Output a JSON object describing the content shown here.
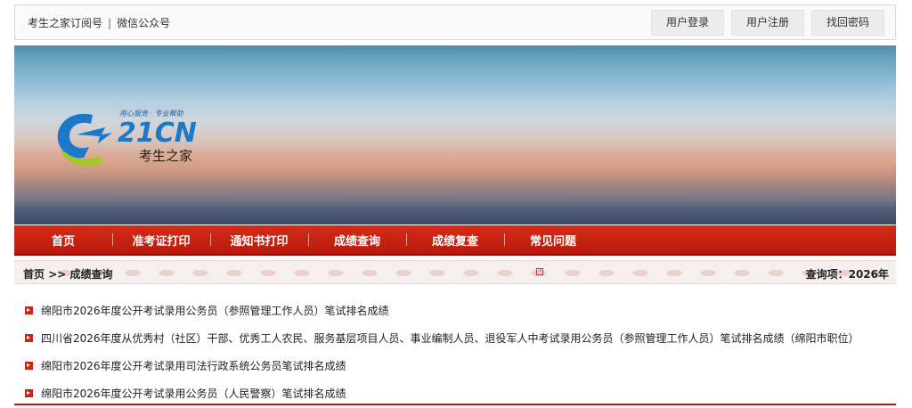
{
  "topbar": {
    "subscribe": "考生之家订阅号",
    "separator": "|",
    "wechat": "微信公众号",
    "buttons": {
      "login": "用户登录",
      "register": "用户注册",
      "recover": "找回密码"
    }
  },
  "logo": {
    "brand": "21CN",
    "slogan": "用心服务 · 专业帮助",
    "name": "考生之家"
  },
  "nav": [
    {
      "label": "首页"
    },
    {
      "label": "准考证打印"
    },
    {
      "label": "通知书打印"
    },
    {
      "label": "成绩查询"
    },
    {
      "label": "成绩复查"
    },
    {
      "label": "常见问题"
    }
  ],
  "breadcrumb": {
    "home": "首页",
    "arrow": ">>",
    "current": "成绩查询",
    "query_label": "查询项：",
    "query_value": "2026年"
  },
  "list": [
    {
      "text": "绵阳市2026年度公开考试录用公务员（参照管理工作人员）笔试排名成绩"
    },
    {
      "text": "四川省2026年度从优秀村（社区）干部、优秀工人农民、服务基层项目人员、事业编制人员、退役军人中考试录用公务员（参照管理工作人员）笔试排名成绩（绵阳市职位）"
    },
    {
      "text": "绵阳市2026年度公开考试录用司法行政系统公务员笔试排名成绩"
    },
    {
      "text": "绵阳市2026年度公开考试录用公务员（人民警察）笔试排名成绩"
    }
  ],
  "colors": {
    "accent_red": "#c9231a",
    "nav_red": "#d52b17"
  }
}
